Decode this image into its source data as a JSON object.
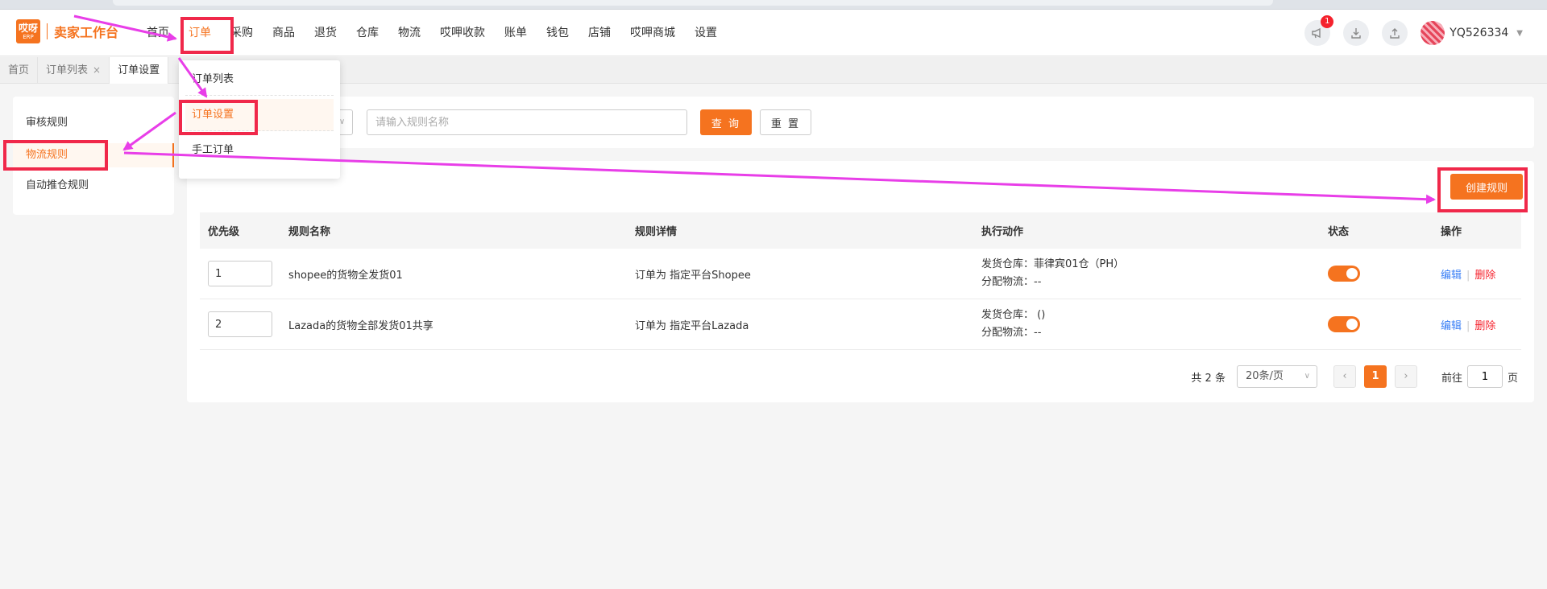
{
  "header": {
    "logo_top": "哎呀",
    "logo_bottom": "ERP",
    "logo_title": "卖家工作台",
    "nav": [
      "首页",
      "订单",
      "采购",
      "商品",
      "退货",
      "仓库",
      "物流",
      "哎呷收款",
      "账单",
      "钱包",
      "店铺",
      "哎呷商城",
      "设置"
    ],
    "active_nav": "订单",
    "notification_count": "1",
    "username": "YQ526334"
  },
  "tabs": {
    "home": "首页",
    "order_list": "订单列表",
    "order_settings": "订单设置",
    "close": "×"
  },
  "dropdown": {
    "items": [
      "订单列表",
      "订单设置",
      "手工订单"
    ],
    "active": "订单设置"
  },
  "sidebar": {
    "items": [
      "审核规则",
      "物流规则",
      "自动推仓规则"
    ],
    "active": "物流规则"
  },
  "search": {
    "placeholder": "请输入规则名称",
    "query_label": "查 询",
    "reset_label": "重 置"
  },
  "main": {
    "create_label": "创建规则",
    "columns": [
      "优先级",
      "规则名称",
      "规则详情",
      "执行动作",
      "状态",
      "操作"
    ],
    "rows": [
      {
        "priority": "1",
        "name": "shopee的货物全发货01",
        "detail": "订单为 指定平台Shopee",
        "action_line1": "发货仓库：菲律宾01仓（PH）",
        "action_line2": "分配物流：--",
        "status": true,
        "edit": "编辑",
        "delete": "删除"
      },
      {
        "priority": "2",
        "name": "Lazada的货物全部发货01共享",
        "detail": "订单为 指定平台Lazada",
        "action_line1": "发货仓库： ()",
        "action_line2": "分配物流：--",
        "status": true,
        "edit": "编辑",
        "delete": "删除"
      }
    ]
  },
  "pagination": {
    "total": "共 2 条",
    "page_size": "20条/页",
    "prev": "‹",
    "current": "1",
    "next": "›",
    "goto_label": "前往",
    "goto_value": "1",
    "page_suffix": "页"
  },
  "colors": {
    "accent": "#f5731f",
    "highlight": "#f0284a",
    "arrow": "#e83ee8"
  }
}
